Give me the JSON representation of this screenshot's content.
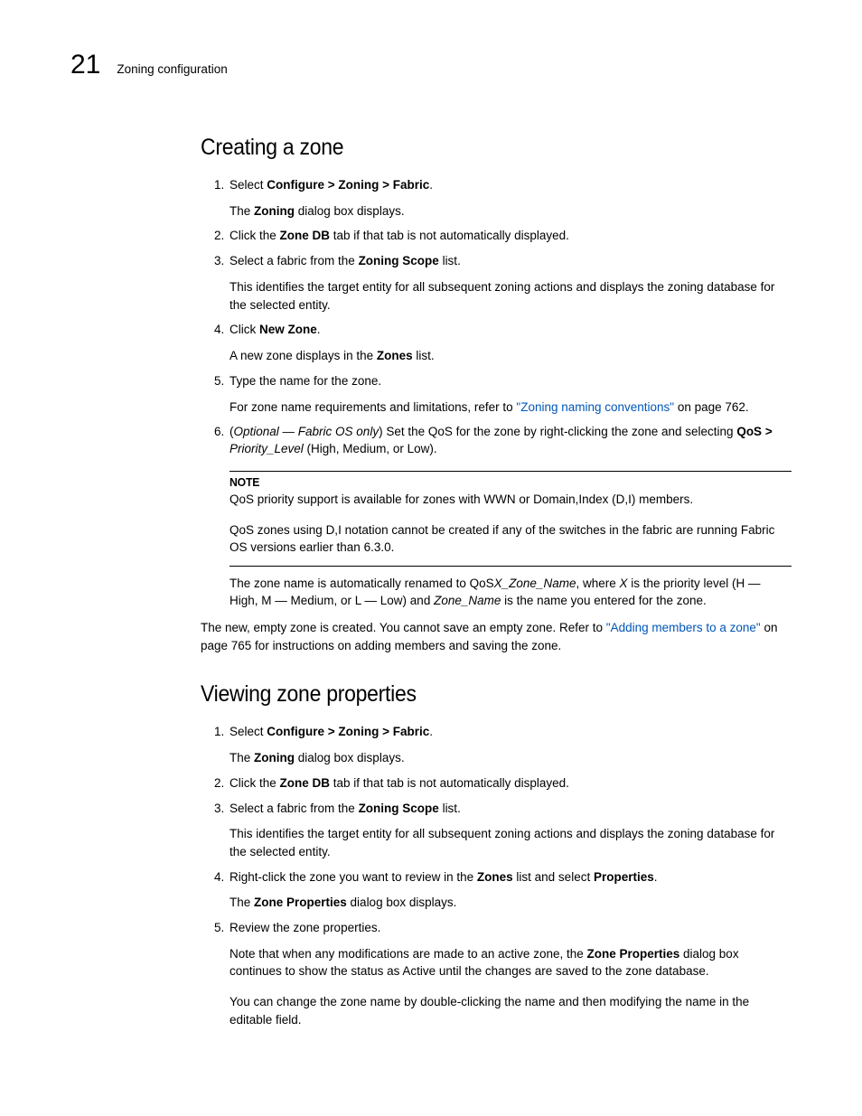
{
  "header": {
    "chapter_num": "21",
    "breadcrumb": "Zoning configuration"
  },
  "section1": {
    "title": "Creating a zone",
    "steps": [
      {
        "prefix": "Select ",
        "bold1": "Configure > Zoning > Fabric",
        "suffix1": ".",
        "sub1_a": "The ",
        "sub1_b": "Zoning",
        "sub1_c": " dialog box displays."
      },
      {
        "prefix": "Click the ",
        "bold1": "Zone DB",
        "suffix1": " tab if that tab is not automatically displayed."
      },
      {
        "prefix": "Select a fabric from the ",
        "bold1": "Zoning Scope",
        "suffix1": " list.",
        "sub1": "This identifies the target entity for all subsequent zoning actions and displays the zoning database for the selected entity."
      },
      {
        "prefix": "Click ",
        "bold1": "New Zone",
        "suffix1": ".",
        "sub1_a": "A new zone displays in the ",
        "sub1_b": "Zones",
        "sub1_c": " list."
      },
      {
        "line": "Type the name for the zone.",
        "sub1_a": "For zone name requirements and limitations, refer to ",
        "link_text": "\"Zoning naming conventions\"",
        "sub1_b": " on page 762."
      },
      {
        "prefix": "(",
        "italic1": "Optional — Fabric OS only",
        "mid": ") Set the QoS for the zone by right-clicking the zone and selecting ",
        "bold1": "QoS > ",
        "italic2": "Priority_Level",
        "suffix1": " (High, Medium, or Low).",
        "note_label": "NOTE",
        "note_p1": "QoS priority support is available for zones with WWN or Domain,Index (D,I) members.",
        "note_p2": "QoS zones using D,I notation cannot be created if any of the switches in the fabric are running Fabric OS versions earlier than 6.3.0.",
        "after_a": "The zone name is automatically renamed to QoS",
        "after_i1": "X_Zone_Name",
        "after_b": ", where ",
        "after_i2": "X",
        "after_c": " is the priority level (H — High, M — Medium, or L — Low) and ",
        "after_i3": "Zone_Name",
        "after_d": " is the name you entered for the zone."
      }
    ],
    "closing_a": "The new, empty zone is created. You cannot save an empty zone. Refer to ",
    "closing_link": "\"Adding members to a zone\"",
    "closing_b": " on page 765 for instructions on adding members and saving the zone."
  },
  "section2": {
    "title": "Viewing zone properties",
    "steps": [
      {
        "prefix": "Select ",
        "bold1": "Configure > Zoning > Fabric",
        "suffix1": ".",
        "sub1_a": "The ",
        "sub1_b": "Zoning",
        "sub1_c": " dialog box displays."
      },
      {
        "prefix": "Click the ",
        "bold1": "Zone DB",
        "suffix1": " tab if that tab is not automatically displayed."
      },
      {
        "prefix": "Select a fabric from the ",
        "bold1": "Zoning Scope",
        "suffix1": " list.",
        "sub1": "This identifies the target entity for all subsequent zoning actions and displays the zoning database for the selected entity."
      },
      {
        "prefix": "Right-click the zone you want to review in the ",
        "bold1": "Zones",
        "mid": " list and select ",
        "bold2": "Properties",
        "suffix1": ".",
        "sub1_a": "The ",
        "sub1_b": "Zone Properties",
        "sub1_c": " dialog box displays."
      },
      {
        "line": "Review the zone properties.",
        "sub1_a": "Note that when any modifications are made to an active zone, the ",
        "sub1_b": "Zone Properties",
        "sub1_c": " dialog box continues to show the status as Active until the changes are saved to the zone database.",
        "sub2": "You can change the zone name by double-clicking the name and then modifying the name in the editable field."
      }
    ]
  }
}
